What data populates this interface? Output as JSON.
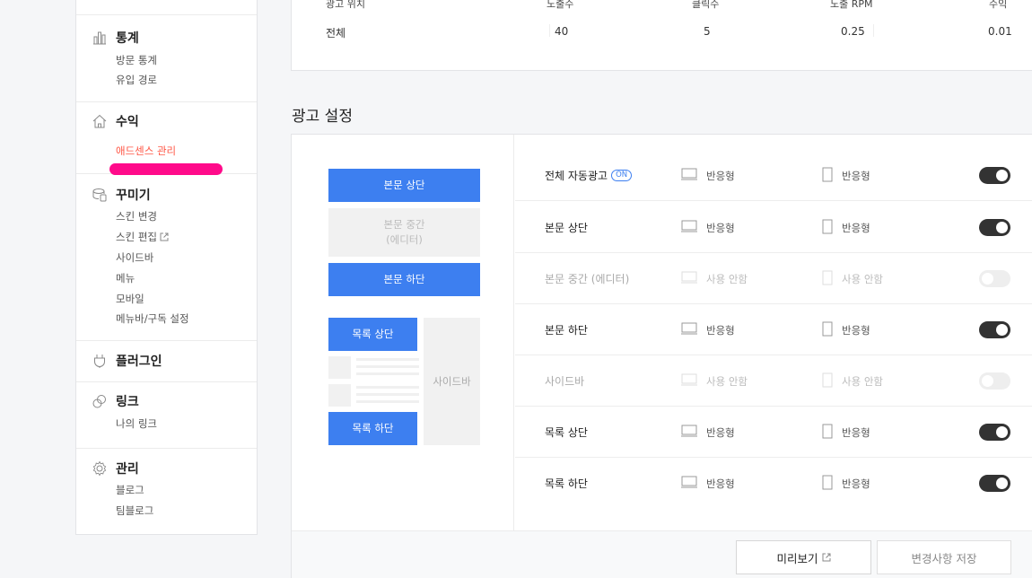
{
  "sidebar": {
    "stats": {
      "title": "통계",
      "items": [
        "방문 통계",
        "유입 경로"
      ]
    },
    "revenue": {
      "title": "수익",
      "items": [
        "애드센스 관리"
      ]
    },
    "decorate": {
      "title": "꾸미기",
      "items": [
        "스킨 변경",
        "스킨 편집",
        "사이드바",
        "메뉴",
        "모바일",
        "메뉴바/구독 설정"
      ]
    },
    "plugin": {
      "title": "플러그인"
    },
    "link": {
      "title": "링크",
      "items": [
        "나의 링크"
      ]
    },
    "manage": {
      "title": "관리",
      "items": [
        "블로그",
        "팀블로그"
      ]
    }
  },
  "stats_table": {
    "headers": [
      "광고 위치",
      "노출수",
      "클릭수",
      "노출 RPM",
      "수익"
    ],
    "row": [
      "전체",
      "40",
      "5",
      "0.25",
      "0.01"
    ]
  },
  "ad_settings": {
    "title": "광고 설정",
    "preview": {
      "top": "본문 상단",
      "middle_line1": "본문 중간",
      "middle_line2": "(에디터)",
      "bottom": "본문 하단",
      "list_top": "목록 상단",
      "list_bottom": "목록 하단",
      "sidebar": "사이드바"
    },
    "rows": [
      {
        "label": "전체 자동광고",
        "badge": "ON",
        "desktop": "반응형",
        "mobile": "반응형",
        "enabled": true
      },
      {
        "label": "본문 상단",
        "desktop": "반응형",
        "mobile": "반응형",
        "enabled": true
      },
      {
        "label": "본문 중간 (에디터)",
        "desktop": "사용 안함",
        "mobile": "사용 안함",
        "enabled": false
      },
      {
        "label": "본문 하단",
        "desktop": "반응형",
        "mobile": "반응형",
        "enabled": true
      },
      {
        "label": "사이드바",
        "desktop": "사용 안함",
        "mobile": "사용 안함",
        "enabled": false
      },
      {
        "label": "목록 상단",
        "desktop": "반응형",
        "mobile": "반응형",
        "enabled": true
      },
      {
        "label": "목록 하단",
        "desktop": "반응형",
        "mobile": "반응형",
        "enabled": true
      }
    ],
    "buttons": {
      "preview": "미리보기",
      "save": "변경사항 저장"
    }
  },
  "colors": {
    "accent": "#3d7ff0",
    "active_menu": "#ff5544",
    "highlight": "#ff0a8a",
    "toggle_on": "#333333"
  }
}
